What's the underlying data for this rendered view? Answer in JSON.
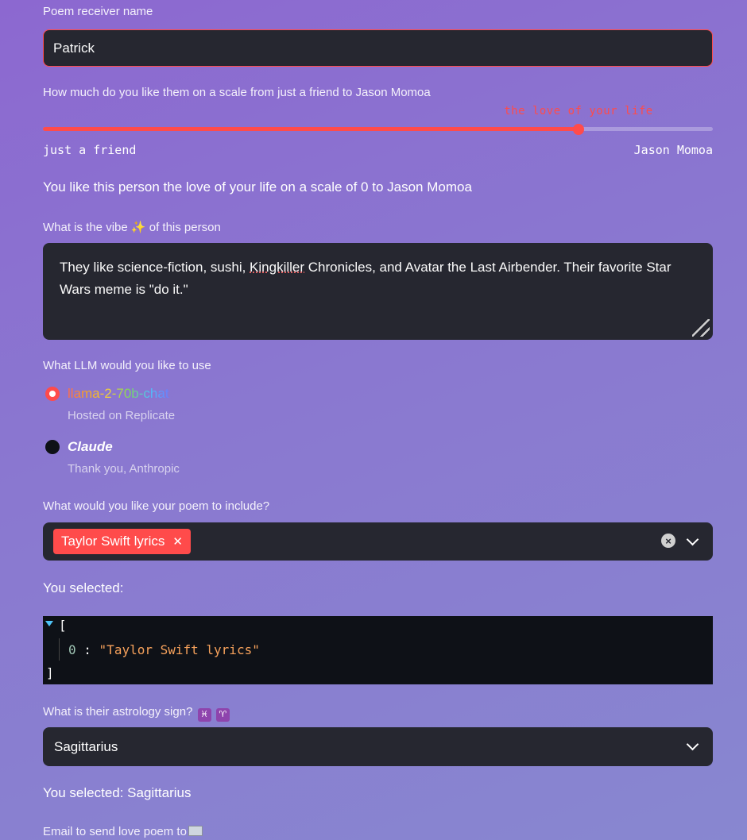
{
  "name_field": {
    "label": "Poem receiver name",
    "value": "Patrick"
  },
  "slider": {
    "label": "How much do you like them on a scale from just a friend to Jason Momoa",
    "value_text": "the love of your life",
    "fraction": 0.8,
    "min_label": "just a friend",
    "max_label": "Jason Momoa",
    "accent_color": "#ff4b4b"
  },
  "slider_result": "You like this person the love of your life on a scale of 0 to Jason Momoa",
  "vibe": {
    "label_before": "What is the vibe",
    "label_icon": "sparkles-icon",
    "label_after": "of this person",
    "text_part1": "They like science-fiction, sushi, ",
    "text_underlined": "Kingkiller",
    "text_part2": " Chronicles, and Avatar the Last Airbender. Their favorite Star Wars meme is \"do it.\""
  },
  "llm": {
    "label": "What LLM would you like to use",
    "options": [
      {
        "name": "llama-2-70b-chat",
        "caption": "Hosted on Replicate",
        "selected": true
      },
      {
        "name": "Claude",
        "caption": "Thank you, Anthropic",
        "selected": false
      }
    ]
  },
  "include": {
    "label": "What would you like your poem to include?",
    "tags": [
      "Taylor Swift lyrics"
    ],
    "selected_label": "You selected:"
  },
  "json_view": {
    "open": "[",
    "index": "0",
    "sep": " : ",
    "value": "\"Taylor Swift lyrics\"",
    "close": "]"
  },
  "sign": {
    "label": "What is their astrology sign?",
    "icons": [
      "♓",
      "♈"
    ],
    "value": "Sagittarius",
    "result": "You selected: Sagittarius"
  },
  "email": {
    "label": "Email to send love poem to",
    "icon": "envelope-icon"
  }
}
